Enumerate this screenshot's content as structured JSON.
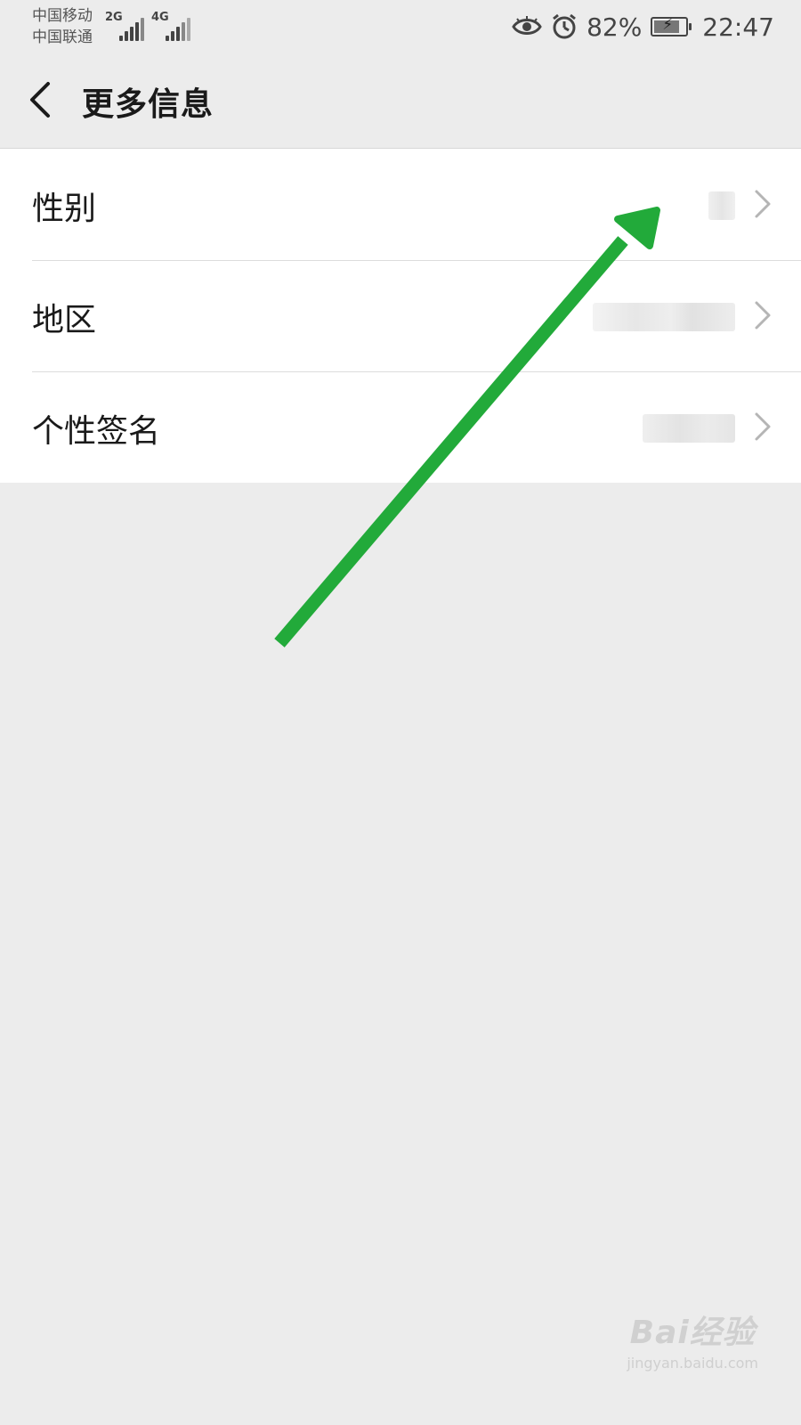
{
  "status_bar": {
    "carrier_1": "中国移动",
    "carrier_2": "中国联通",
    "net_1": "2G",
    "net_2": "4G",
    "battery_percent": "82%",
    "battery_level": 0.82,
    "time": "22:47",
    "icons": [
      "eye-icon",
      "alarm-icon",
      "battery-charging-icon"
    ]
  },
  "header": {
    "title": "更多信息"
  },
  "rows": [
    {
      "label": "性别",
      "value_state": "blurred"
    },
    {
      "label": "地区",
      "value_state": "blurred"
    },
    {
      "label": "个性签名",
      "value_state": "blurred"
    }
  ],
  "annotation": {
    "type": "arrow",
    "color": "#22aa3a",
    "points_to": "性别"
  },
  "watermark": {
    "brand": "Bai经验",
    "site": "jingyan.baidu.com"
  },
  "colors": {
    "background": "#ececec",
    "list_background": "#ffffff",
    "divider": "#dcdcdc",
    "chevron": "#b5b5b5",
    "arrow": "#22aa3a"
  }
}
